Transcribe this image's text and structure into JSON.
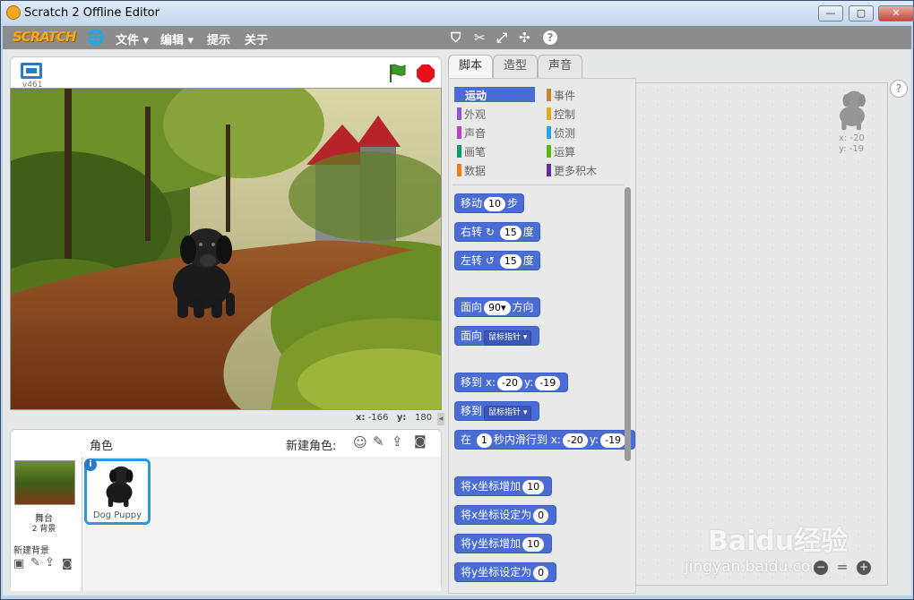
{
  "window": {
    "title": "Scratch 2 Offline Editor"
  },
  "menu": {
    "logo": "SCRATCH",
    "items": [
      "文件 ▾",
      "编辑 ▾",
      "提示",
      "关于"
    ]
  },
  "stage": {
    "version": "v461",
    "mouse_x_label": "x:",
    "mouse_x": "-166",
    "mouse_y_label": "y:",
    "mouse_y": "180"
  },
  "sprites_panel": {
    "title": "角色",
    "new_sprite_label": "新建角色:",
    "stage_label": "舞台",
    "backdrops_count": "2 背景",
    "new_backdrop_label": "新建背景",
    "sprite_name": "Dog Puppy"
  },
  "tabs": [
    "脚本",
    "造型",
    "声音"
  ],
  "categories_left": [
    "运动",
    "外观",
    "声音",
    "画笔",
    "数据"
  ],
  "categories_right": [
    "事件",
    "控制",
    "侦测",
    "运算",
    "更多积木"
  ],
  "colors": {
    "motion": "#4a6cd4",
    "looks": "#8a55d7",
    "sound": "#bb42c3",
    "pen": "#0e9a6c",
    "data": "#ee7d16",
    "events": "#c88330",
    "control": "#e1a91a",
    "sensing": "#2ca5e2",
    "operators": "#5cb712",
    "more": "#632d99"
  },
  "blocks": {
    "move": {
      "a": "移动",
      "n": "10",
      "b": "步"
    },
    "turn_right": {
      "a": "右转",
      "n": "15",
      "b": "度"
    },
    "turn_left": {
      "a": "左转",
      "n": "15",
      "b": "度"
    },
    "point_dir": {
      "a": "面向",
      "n": "90▾",
      "b": "方向"
    },
    "point_towards": {
      "a": "面向",
      "d": "鼠标指针 ▾"
    },
    "goto_xy": {
      "a": "移到",
      "xl": "x:",
      "x": "-20",
      "yl": "y:",
      "y": "-19"
    },
    "goto": {
      "a": "移到",
      "d": "鼠标指针 ▾"
    },
    "glide": {
      "a": "在",
      "n": "1",
      "b": "秒内滑行到",
      "xl": "x:",
      "x": "-20",
      "yl": "y:",
      "y": "-19"
    },
    "change_x": {
      "a": "将x坐标增加",
      "n": "10"
    },
    "set_x": {
      "a": "将x坐标设定为",
      "n": "0"
    },
    "change_y": {
      "a": "将y坐标增加",
      "n": "10"
    },
    "set_y": {
      "a": "将y坐标设定为",
      "n": "0"
    }
  },
  "sprite_info": {
    "x": "x: -20",
    "y": "y: -19"
  },
  "watermark": {
    "brand": "Baidu经验",
    "url": "jingyan.baidu.com"
  }
}
